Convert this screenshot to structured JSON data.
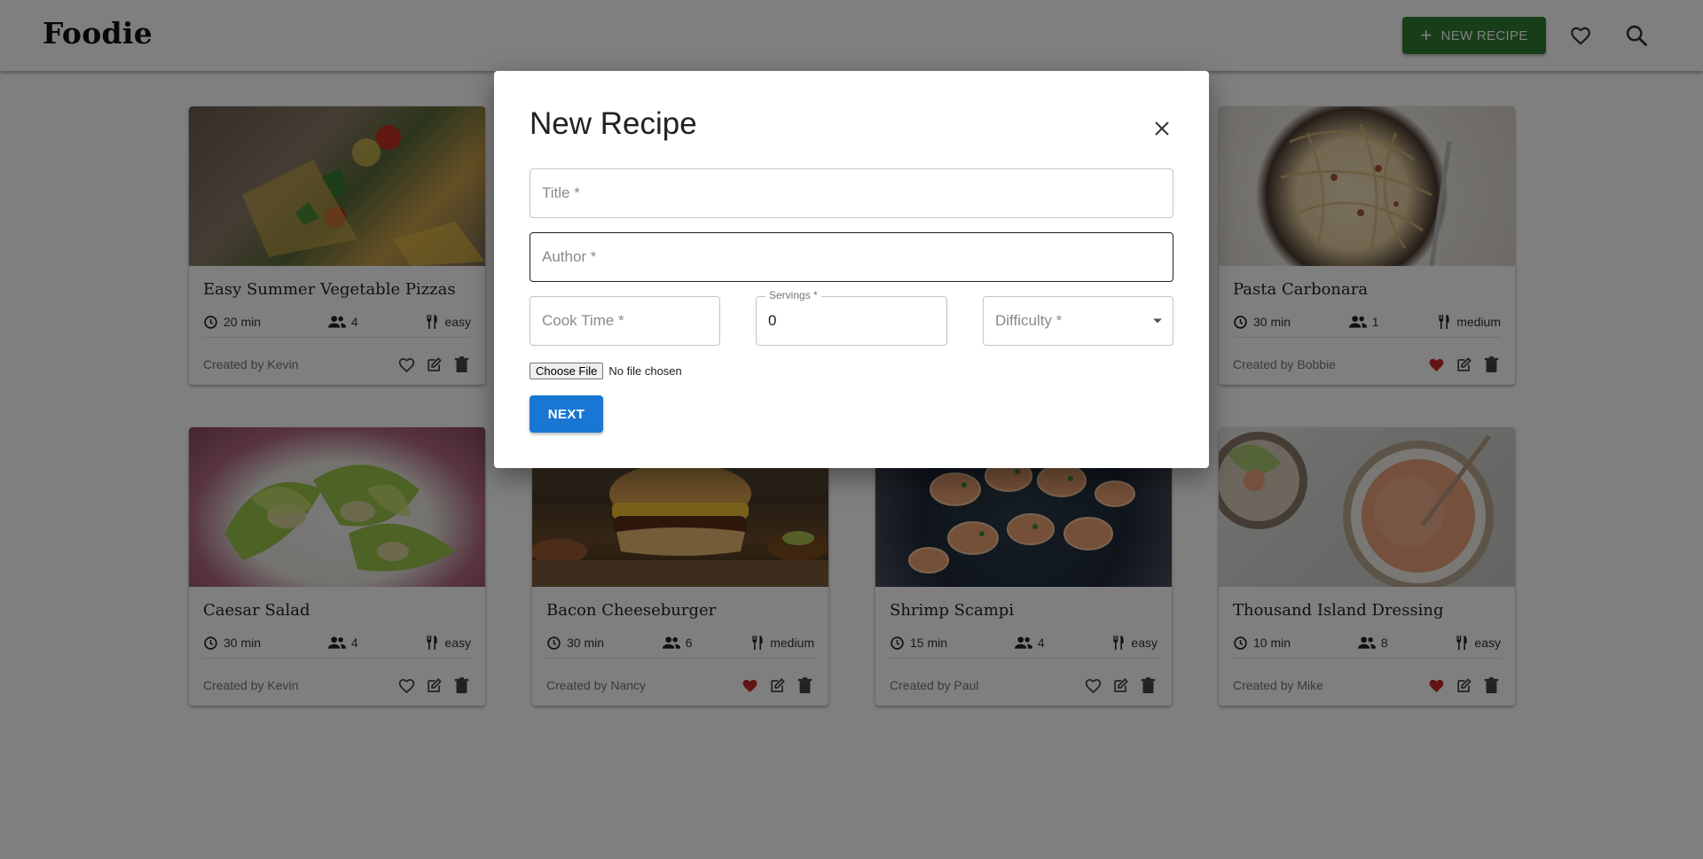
{
  "header": {
    "brand": "Foodie",
    "new_recipe_label": "NEW RECIPE",
    "icons": [
      "heart-outline-icon",
      "search-icon"
    ]
  },
  "colors": {
    "primary_green": "#2e7d32",
    "primary_blue": "#1976d2",
    "favorite_red": "#c62828"
  },
  "recipes": [
    {
      "title": "Easy Summer Vegetable Pizzas",
      "time": "20 min",
      "servings": "4",
      "difficulty": "easy",
      "author": "Created by Kevin",
      "favorite": false
    },
    {
      "title": "",
      "time": "",
      "servings": "",
      "difficulty": "",
      "author": "",
      "favorite": false
    },
    {
      "title": "",
      "time": "",
      "servings": "",
      "difficulty": "",
      "author": "",
      "favorite": false
    },
    {
      "title": "Pasta Carbonara",
      "time": "30 min",
      "servings": "1",
      "difficulty": "medium",
      "author": "Created by Bobbie",
      "favorite": true
    },
    {
      "title": "Caesar Salad",
      "time": "30 min",
      "servings": "4",
      "difficulty": "easy",
      "author": "Created by Kevin",
      "favorite": false
    },
    {
      "title": "Bacon Cheeseburger",
      "time": "30 min",
      "servings": "6",
      "difficulty": "medium",
      "author": "Created by Nancy",
      "favorite": true
    },
    {
      "title": "Shrimp Scampi",
      "time": "15 min",
      "servings": "4",
      "difficulty": "easy",
      "author": "Created by Paul",
      "favorite": false
    },
    {
      "title": "Thousand Island Dressing",
      "time": "10 min",
      "servings": "8",
      "difficulty": "easy",
      "author": "Created by Mike",
      "favorite": true
    }
  ],
  "dialog": {
    "title": "New Recipe",
    "fields": {
      "title_placeholder": "Title *",
      "author_placeholder": "Author *",
      "cook_time_placeholder": "Cook Time *",
      "servings_label": "Servings *",
      "servings_value": "0",
      "difficulty_placeholder": "Difficulty *"
    },
    "file": {
      "button": "Choose File",
      "status": "No file chosen"
    },
    "next_label": "NEXT"
  }
}
